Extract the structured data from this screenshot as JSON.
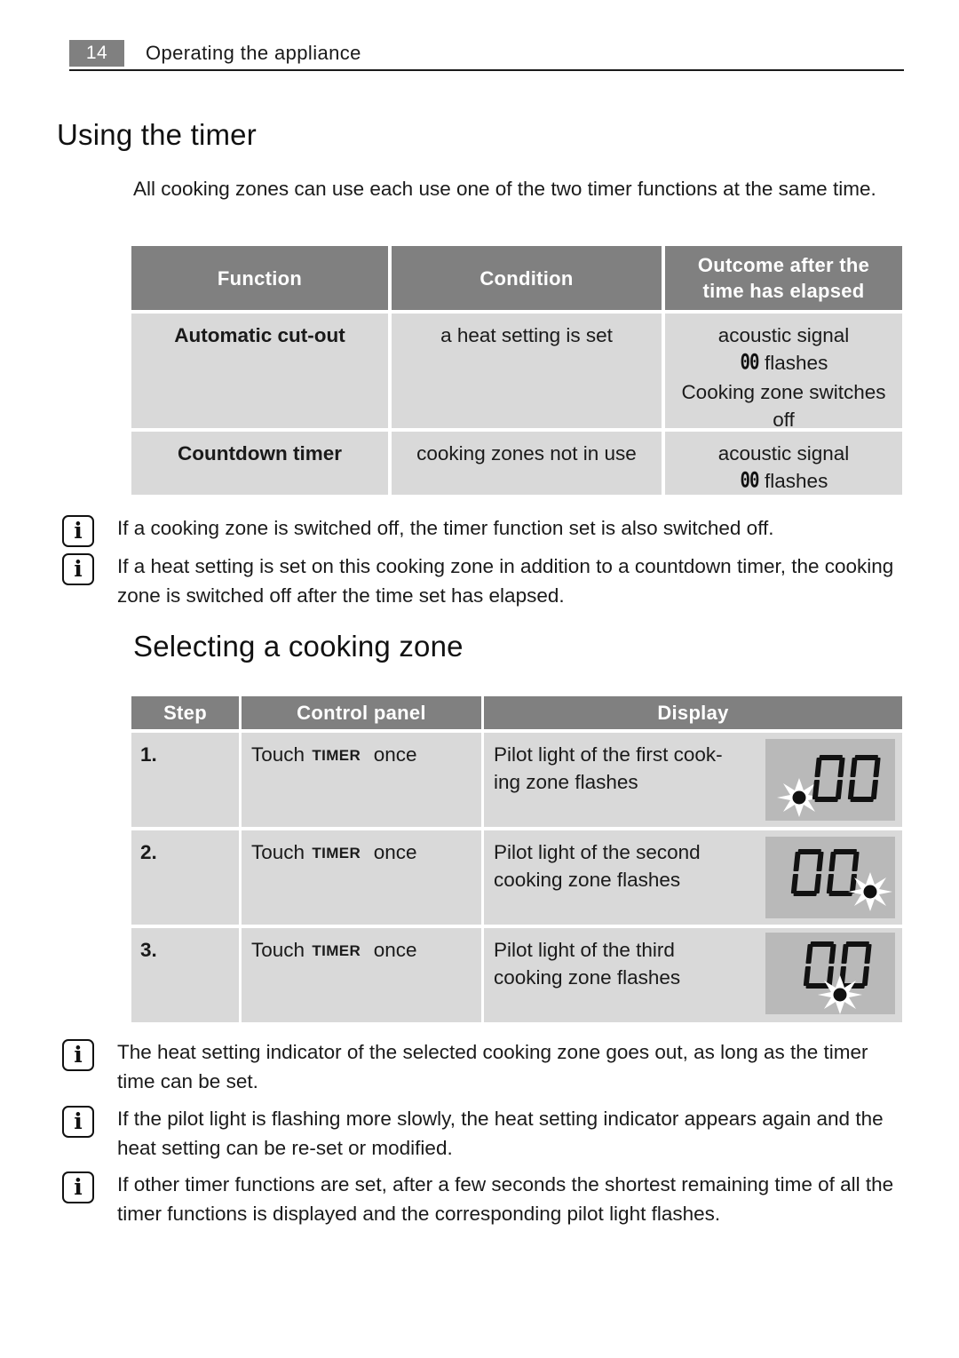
{
  "header": {
    "page_number": "14",
    "title": "Operating the appliance"
  },
  "section_timer": {
    "heading": "Using the timer",
    "intro": "All cooking zones can use each use one of the two timer functions at the same time.",
    "table": {
      "headers": [
        "Function",
        "Condition",
        "Outcome after the\ntime has elapsed"
      ],
      "rows": [
        {
          "function": "Automatic cut-out",
          "condition": "a heat setting is set",
          "outcome_line1": "acoustic signal",
          "outcome_seg": "00",
          "outcome_seg_suffix": "flashes",
          "outcome_line3": "Cooking zone switches",
          "outcome_line4": "off"
        },
        {
          "function": "Countdown timer",
          "condition": "cooking zones not in use",
          "outcome_line1": "acoustic signal",
          "outcome_seg": "00",
          "outcome_seg_suffix": "flashes",
          "outcome_line3": "",
          "outcome_line4": ""
        }
      ]
    },
    "notes": [
      "If a cooking zone is switched off, the timer function set is also switched off.",
      "If a heat setting is set on this cooking zone in addition to a countdown timer, the cooking zone is switched off after the time set has elapsed."
    ]
  },
  "section_zone": {
    "heading": "Selecting a cooking zone",
    "table": {
      "headers": [
        "Step",
        "Control panel",
        "Display"
      ],
      "rows": [
        {
          "step": "1.",
          "control_prefix": "Touch",
          "control_key": "TIMER",
          "control_suffix": "once",
          "display_text": "Pilot light of the first cook-\ning zone flashes",
          "display_digits": "00",
          "pilot_position": "left"
        },
        {
          "step": "2.",
          "control_prefix": "Touch",
          "control_key": "TIMER",
          "control_suffix": "once",
          "display_text": "Pilot light of the second\ncooking zone flashes",
          "display_digits": "00",
          "pilot_position": "right"
        },
        {
          "step": "3.",
          "control_prefix": "Touch",
          "control_key": "TIMER",
          "control_suffix": "once",
          "display_text": "Pilot light of the third\ncooking zone flashes",
          "display_digits": "00",
          "pilot_position": "bottom"
        }
      ]
    },
    "notes": [
      "The heat setting indicator of the selected cooking zone goes out, as long as the timer time can be set.",
      "If the pilot light is flashing more slowly, the heat setting indicator appears again and the heat setting can be re-set or modified.",
      "If other timer functions are set, after a few seconds the shortest remaining time of all the timer functions is displayed and the corresponding pilot light flashes."
    ]
  },
  "icons": {
    "info": "i"
  },
  "colors": {
    "table_header_bg": "#808080",
    "table_body_bg": "#d9d9d9",
    "display_bg": "#b9b9b9",
    "text": "#1a1a1a"
  }
}
